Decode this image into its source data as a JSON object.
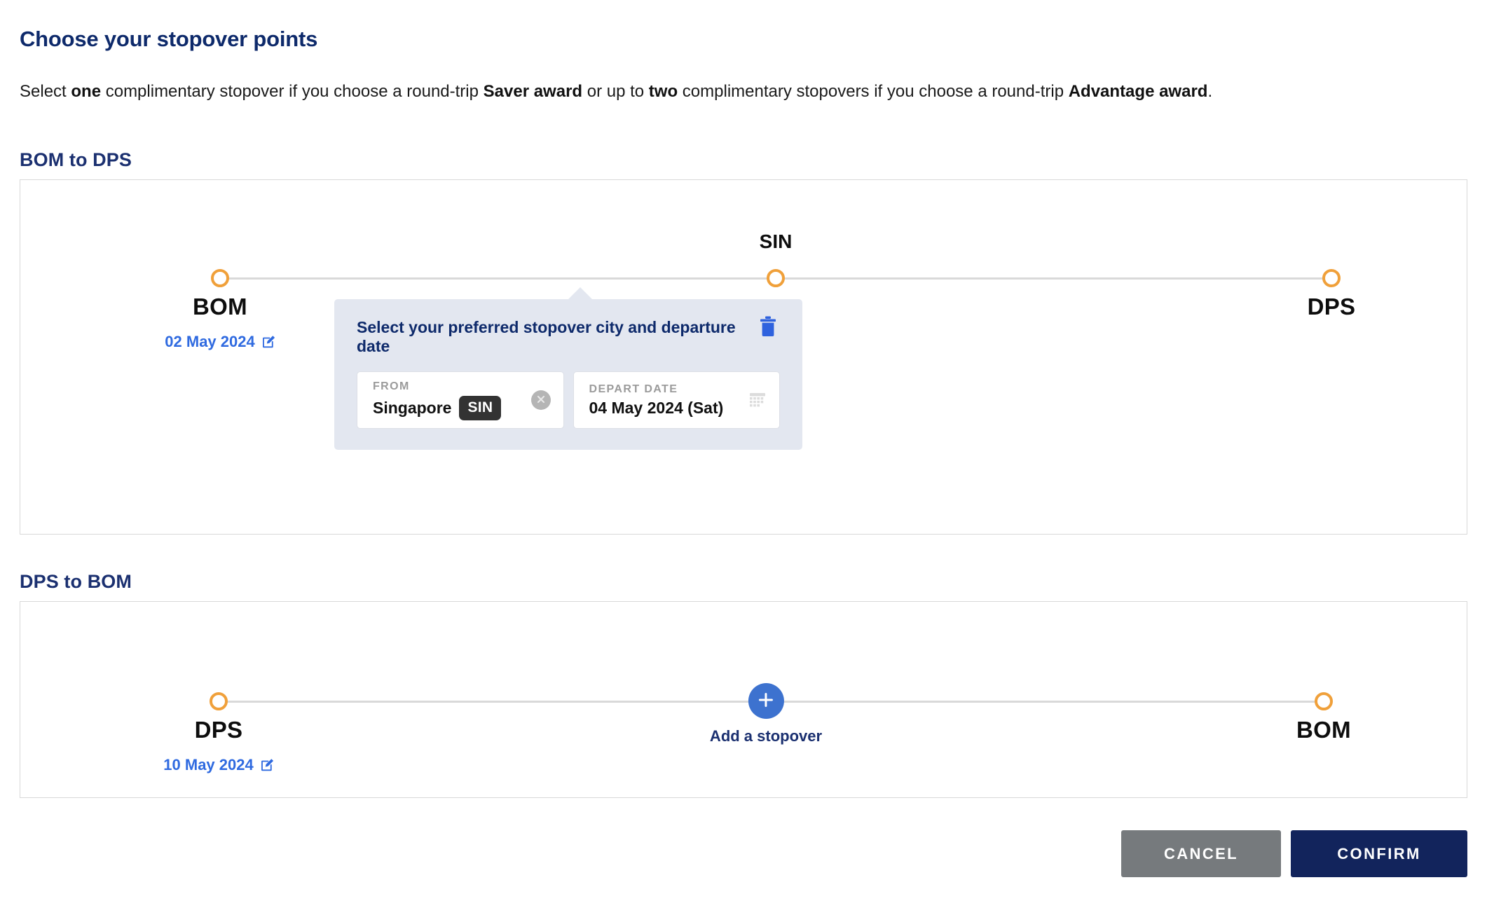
{
  "header": {
    "title": "Choose your stopover points",
    "subtitle_parts": [
      {
        "text": "Select ",
        "bold": false
      },
      {
        "text": "one",
        "bold": true
      },
      {
        "text": " complimentary stopover if you choose a round-trip ",
        "bold": false
      },
      {
        "text": "Saver award",
        "bold": true
      },
      {
        "text": " or up to ",
        "bold": false
      },
      {
        "text": "two",
        "bold": true
      },
      {
        "text": " complimentary stopovers if you choose a round-trip ",
        "bold": false
      },
      {
        "text": "Advantage award",
        "bold": true
      },
      {
        "text": ".",
        "bold": false
      }
    ],
    "subtitle_plain": "Select one complimentary stopover if you choose a round-trip Saver award or up to two complimentary stopovers if you choose a round-trip Advantage award."
  },
  "sections": [
    {
      "heading": "BOM to DPS",
      "origin": {
        "code": "BOM",
        "date": "02 May 2024",
        "edit_icon": "edit-pencil-icon"
      },
      "stopover": {
        "code": "SIN"
      },
      "destination": {
        "code": "DPS",
        "date": ""
      }
    },
    {
      "heading": "DPS to BOM",
      "origin": {
        "code": "DPS",
        "date": "10 May 2024",
        "edit_icon": "edit-pencil-icon"
      },
      "add_stopover_label": "Add a stopover",
      "destination": {
        "code": "BOM",
        "date": ""
      }
    }
  ],
  "stopover_card": {
    "title": "Select your preferred stopover city and departure date",
    "delete_icon": "trash-icon",
    "from_field": {
      "label": "FROM",
      "city": "Singapore",
      "code": "SIN",
      "clear_icon": "close-circle-icon"
    },
    "date_field": {
      "label": "DEPART DATE",
      "value": "04 May 2024 (Sat)",
      "calendar_icon": "calendar-icon"
    }
  },
  "footer": {
    "cancel_label": "CANCEL",
    "confirm_label": "CONFIRM"
  },
  "colors": {
    "navy": "#0e2a6b",
    "heading_navy": "#1b3070",
    "orange_node": "#f0a03a",
    "link_blue": "#2f6ae0",
    "card_bg": "#e3e7f0",
    "add_blue": "#3d72cf",
    "cancel_gray": "#767a7d",
    "confirm_navy": "#12245c",
    "badge_dark": "#333333"
  }
}
